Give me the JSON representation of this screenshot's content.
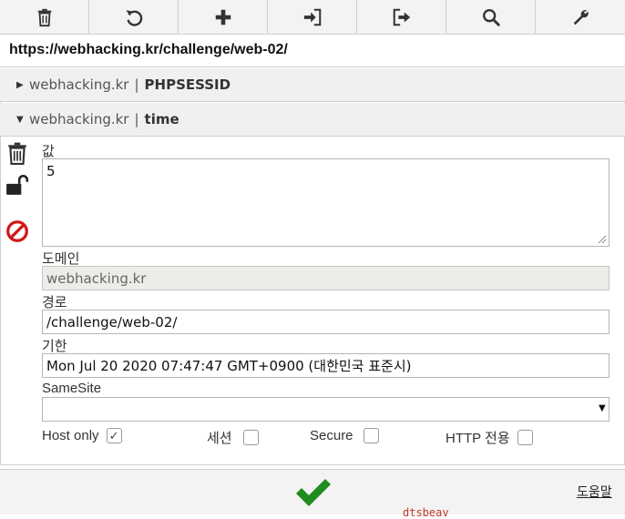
{
  "toolbar": {
    "buttons": [
      {
        "name": "delete-all-button",
        "icon": "trash-icon"
      },
      {
        "name": "reset-button",
        "icon": "undo-icon"
      },
      {
        "name": "add-cookie-button",
        "icon": "plus-icon"
      },
      {
        "name": "import-button",
        "icon": "import-icon"
      },
      {
        "name": "export-button",
        "icon": "export-icon"
      },
      {
        "name": "search-button",
        "icon": "search-icon"
      },
      {
        "name": "settings-button",
        "icon": "wrench-icon"
      }
    ]
  },
  "url": "https://webhacking.kr/challenge/web-02/",
  "cookies": [
    {
      "domain": "webhacking.kr",
      "separator": "|",
      "name": "PHPSESSID",
      "expanded": false
    },
    {
      "domain": "webhacking.kr",
      "separator": "|",
      "name": "time",
      "expanded": true
    }
  ],
  "editor": {
    "value_label": "값",
    "value": "5",
    "domain_label": "도메인",
    "domain": "webhacking.kr",
    "path_label": "경로",
    "path": "/challenge/web-02/",
    "expiry_label": "기한",
    "expiry": "Mon Jul 20 2020 07:47:47 GMT+0900 (대한민국 표준시)",
    "samesite_label": "SameSite",
    "samesite": "",
    "host_only_label": "Host only",
    "host_only": true,
    "session_label": "세션",
    "session": false,
    "secure_label": "Secure",
    "secure": false,
    "http_only_label": "HTTP 전용",
    "http_only": false
  },
  "footer": {
    "help_label": "도움말",
    "bleed_text": "dtsbeav"
  },
  "colors": {
    "save_check": "#1e8c1e",
    "block_icon": "#d01818"
  }
}
